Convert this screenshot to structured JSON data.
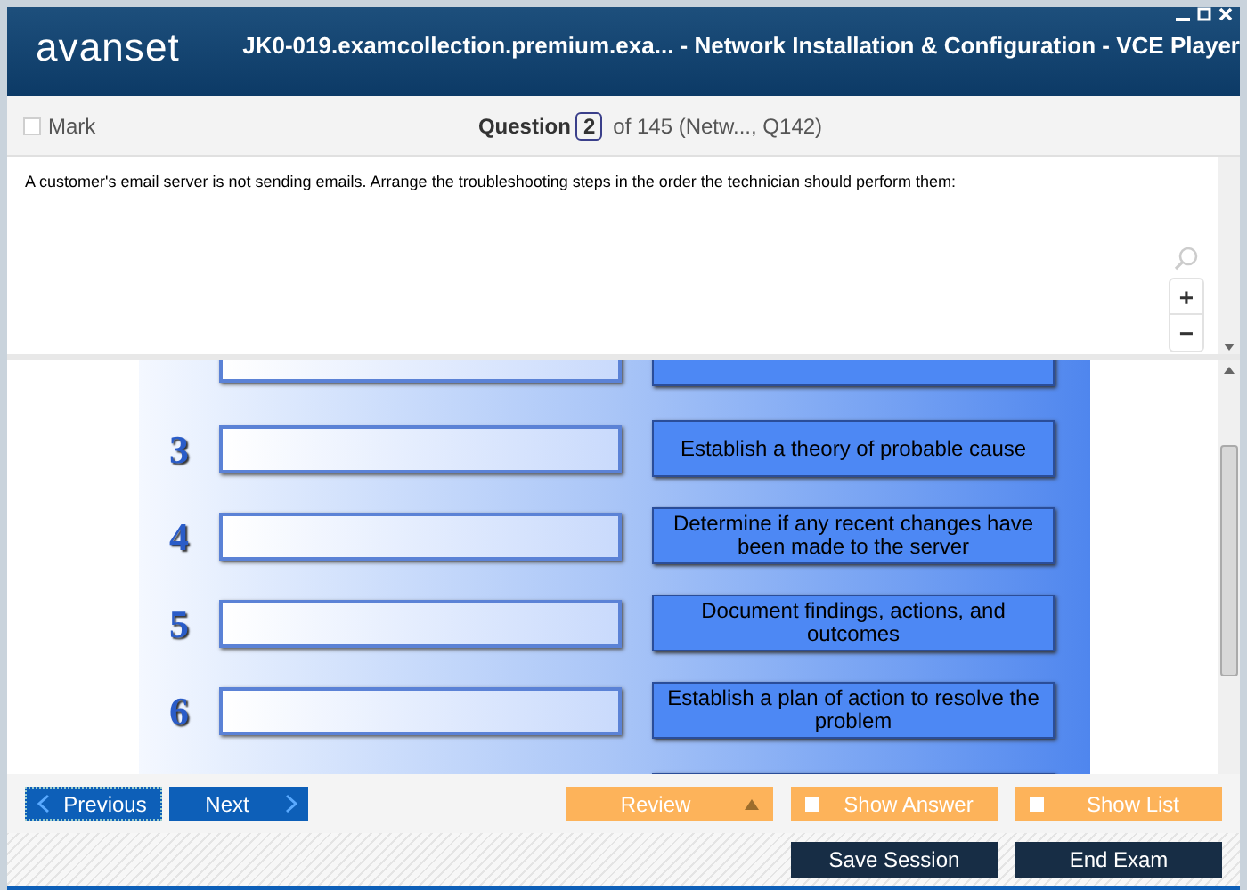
{
  "window": {
    "logo": "avanset",
    "title": "JK0-019.examcollection.premium.exa... - Network Installation & Configuration  - VCE Player"
  },
  "toolbar": {
    "mark": {
      "label": "Mark",
      "checked": false
    },
    "question_label": "Question",
    "question_number": "2",
    "question_rest": "of 145 (Netw..., Q142)"
  },
  "question": {
    "text": "A customer's email server is not sending emails. Arrange the troubleshooting steps in the order the technician should perform them:",
    "zoom_in": "+",
    "zoom_out": "−"
  },
  "exhibit": {
    "rows": [
      {
        "number": "3",
        "step": "Establish a theory of probable cause"
      },
      {
        "number": "4",
        "step": "Determine if any recent changes have been made to the server"
      },
      {
        "number": "5",
        "step": "Document findings, actions, and outcomes"
      },
      {
        "number": "6",
        "step": "Establish a plan of action to resolve the problem"
      }
    ]
  },
  "nav": {
    "previous": "Previous",
    "next": "Next",
    "review": "Review",
    "toggles": [
      {
        "label": "Show Answer",
        "checked": false
      },
      {
        "label": "Show List",
        "checked": false
      }
    ]
  },
  "footer": {
    "buttons": [
      "Save Session",
      "End Exam"
    ]
  }
}
